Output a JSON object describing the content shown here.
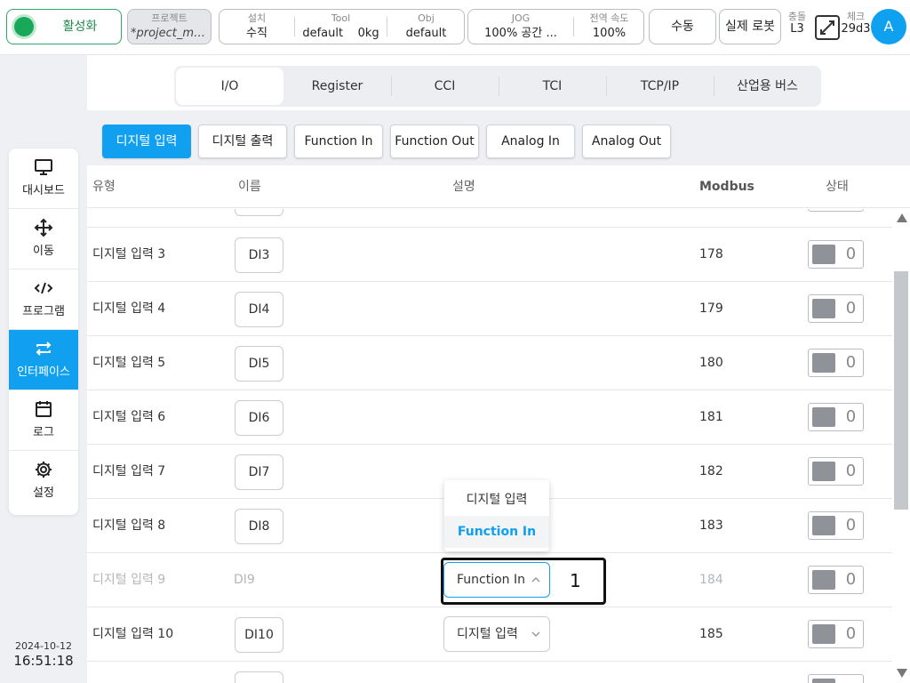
{
  "topbar": {
    "activate_label": "활성화",
    "project_caption": "프로젝트",
    "project_name": "*project_mo...",
    "install_caption": "설치",
    "install_value": "수직",
    "tool_caption": "Tool",
    "tool_value": "default",
    "tool_weight": "0kg",
    "obj_caption": "Obj",
    "obj_value": "default",
    "jog_caption": "JOG",
    "jog_value": "100%  공간 ...",
    "speed_caption": "전역 속도",
    "speed_value": "100%",
    "manual_label": "수동",
    "real_robot_label": "실제 로봇",
    "collision_caption": "충돌",
    "collision_value": "L3",
    "check_caption": "체크",
    "check_value": "29d3",
    "avatar_letter": "A"
  },
  "sidebar": {
    "items": [
      {
        "label": "대시보드",
        "icon": "monitor-icon"
      },
      {
        "label": "이동",
        "icon": "move-icon"
      },
      {
        "label": "프로그램",
        "icon": "code-icon"
      },
      {
        "label": "인터페이스",
        "icon": "interface-icon"
      },
      {
        "label": "로그",
        "icon": "calendar-icon"
      },
      {
        "label": "설정",
        "icon": "gear-icon"
      }
    ],
    "active_index": 3,
    "date": "2024-10-12",
    "time": "16:51:18"
  },
  "tabs": [
    "I/O",
    "Register",
    "CCI",
    "TCI",
    "TCP/IP",
    "산업용 버스"
  ],
  "active_tab": "I/O",
  "subtabs": [
    "디지털 입력",
    "디지털 출력",
    "Function In",
    "Function Out",
    "Analog In",
    "Analog Out"
  ],
  "active_subtab": "디지털 입력",
  "table": {
    "headers": {
      "type": "유형",
      "name": "이름",
      "desc": "설명",
      "modbus": "Modbus",
      "status": "상태"
    },
    "rows": [
      {
        "type": "디지털 입력 3",
        "name": "DI3",
        "desc": "",
        "modbus": "178",
        "status": "0"
      },
      {
        "type": "디지털 입력 4",
        "name": "DI4",
        "desc": "",
        "modbus": "179",
        "status": "0"
      },
      {
        "type": "디지털 입력 5",
        "name": "DI5",
        "desc": "",
        "modbus": "180",
        "status": "0"
      },
      {
        "type": "디지털 입력 6",
        "name": "DI6",
        "desc": "",
        "modbus": "181",
        "status": "0"
      },
      {
        "type": "디지털 입력 7",
        "name": "DI7",
        "desc": "",
        "modbus": "182",
        "status": "0"
      },
      {
        "type": "디지털 입력 8",
        "name": "DI8",
        "desc": "",
        "modbus": "183",
        "status": "0"
      },
      {
        "type": "디지털 입력 9",
        "name": "DI9",
        "desc": "Function In",
        "modbus": "184",
        "status": "0"
      },
      {
        "type": "디지털 입력 10",
        "name": "DI10",
        "desc": "디지털 입력",
        "modbus": "185",
        "status": "0"
      }
    ]
  },
  "dropdown": {
    "options": [
      "디지털 입력",
      "Function In"
    ],
    "selected": "Function In"
  },
  "annotation_number": "1",
  "colors": {
    "accent": "#10a0ef",
    "active_led": "#18a85a",
    "status_grey": "#8f9399"
  }
}
